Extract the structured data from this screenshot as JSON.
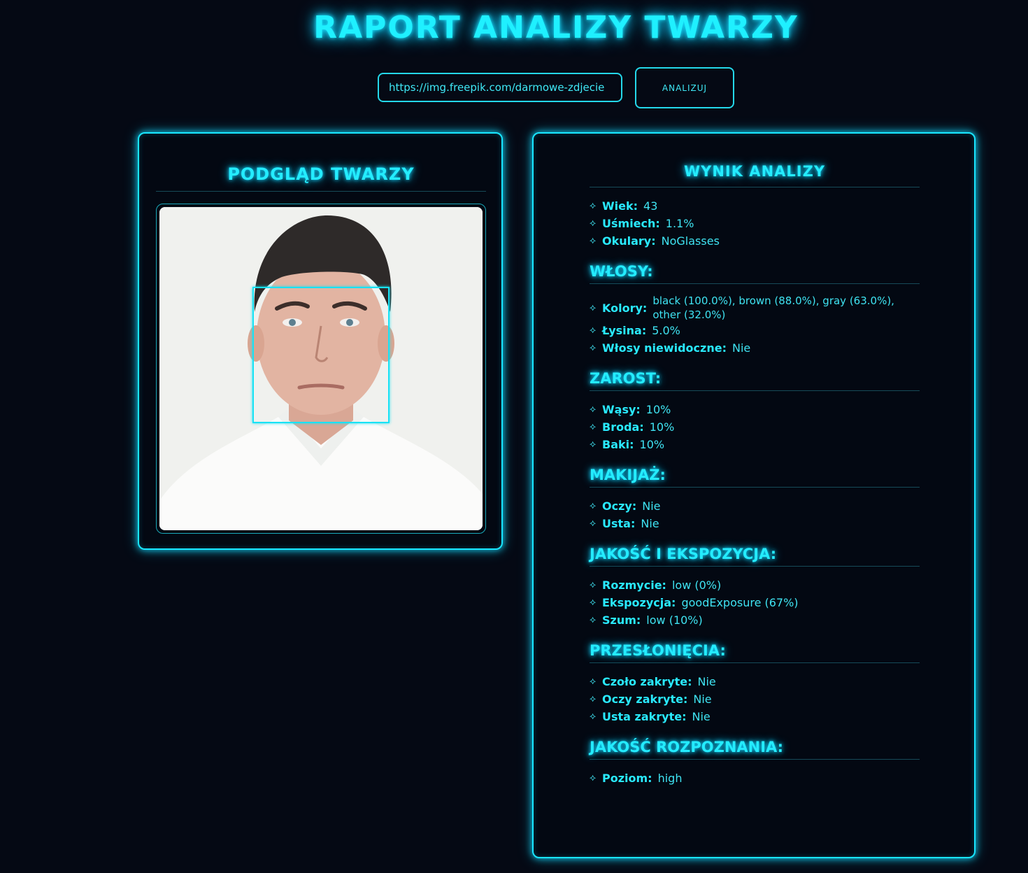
{
  "header": {
    "title": "RAPORT ANALIZY TWARZY"
  },
  "form": {
    "url_value": "https://img.freepik.com/darmowe-zdjecie",
    "analyze_label": "ANALIZUJ"
  },
  "preview": {
    "heading": "PODGLĄD TWARZY"
  },
  "results": {
    "heading": "WYNIK ANALIZY",
    "basic": [
      {
        "key": "Wiek:",
        "value": "43"
      },
      {
        "key": "Uśmiech:",
        "value": "1.1%"
      },
      {
        "key": "Okulary:",
        "value": "NoGlasses"
      }
    ],
    "hair": {
      "title": "WŁOSY:",
      "items": [
        {
          "key": "Kolory:",
          "value": "black (100.0%), brown (88.0%), gray (63.0%), other (32.0%)"
        },
        {
          "key": "Łysina:",
          "value": "5.0%"
        },
        {
          "key": "Włosy niewidoczne:",
          "value": "Nie"
        }
      ]
    },
    "facial_hair": {
      "title": "ZAROST:",
      "items": [
        {
          "key": "Wąsy:",
          "value": "10%"
        },
        {
          "key": "Broda:",
          "value": "10%"
        },
        {
          "key": "Baki:",
          "value": "10%"
        }
      ]
    },
    "makeup": {
      "title": "MAKIJAŻ:",
      "items": [
        {
          "key": "Oczy:",
          "value": "Nie"
        },
        {
          "key": "Usta:",
          "value": "Nie"
        }
      ]
    },
    "quality": {
      "title": "JAKOŚĆ I EKSPOZYCJA:",
      "items": [
        {
          "key": "Rozmycie:",
          "value": "low (0%)"
        },
        {
          "key": "Ekspozycja:",
          "value": "goodExposure (67%)"
        },
        {
          "key": "Szum:",
          "value": "low (10%)"
        }
      ]
    },
    "occlusion": {
      "title": "PRZESŁONIĘCIA:",
      "items": [
        {
          "key": "Czoło zakryte:",
          "value": "Nie"
        },
        {
          "key": "Oczy zakryte:",
          "value": "Nie"
        },
        {
          "key": "Usta zakryte:",
          "value": "Nie"
        }
      ]
    },
    "recognition": {
      "title": "JAKOŚĆ ROZPOZNANIA:",
      "items": [
        {
          "key": "Poziom:",
          "value": "high"
        }
      ]
    },
    "bullet": "⟡"
  },
  "colors": {
    "accent": "#19e6ff",
    "background": "#050914"
  }
}
